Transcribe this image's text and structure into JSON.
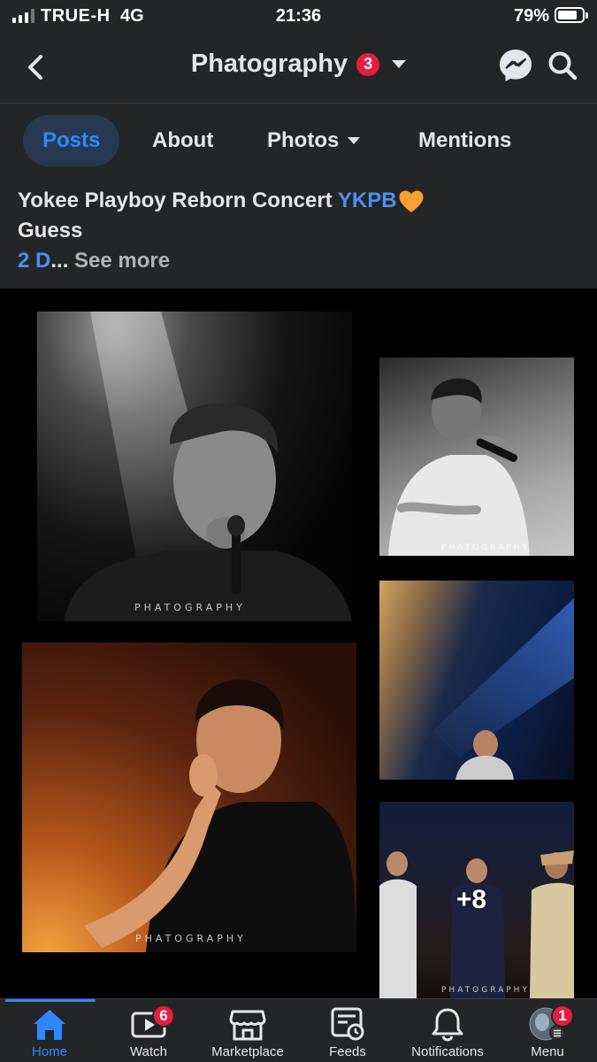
{
  "status_bar": {
    "carrier": "TRUE-H",
    "network": "4G",
    "time": "21:36",
    "battery_percent": "79%",
    "battery_level": 0.79,
    "signal_bars": 3
  },
  "header": {
    "title": "Phatography",
    "notification_count": "3",
    "icons": [
      "back-arrow-icon",
      "chevron-down-icon",
      "messenger-icon",
      "search-icon"
    ]
  },
  "tabs": [
    {
      "label": "Posts",
      "active": true
    },
    {
      "label": "About",
      "active": false
    },
    {
      "label": "Photos",
      "active": false,
      "has_dropdown": true
    },
    {
      "label": "Mentions",
      "active": false
    }
  ],
  "post": {
    "line1": "Yokee Playboy Reborn Concert ",
    "hashtag": "YKPB",
    "line2": "Guess",
    "truncated": "2 D",
    "ellipsis": "...",
    "see_more": " See more"
  },
  "photos": {
    "watermark": "PHATOGRAPHY",
    "more_count": "+8"
  },
  "bottom_nav": [
    {
      "label": "Home",
      "icon": "home-icon",
      "active": true,
      "badge": ""
    },
    {
      "label": "Watch",
      "icon": "watch-icon",
      "active": false,
      "badge": "6"
    },
    {
      "label": "Marketplace",
      "icon": "marketplace-icon",
      "active": false,
      "badge": ""
    },
    {
      "label": "Feeds",
      "icon": "feeds-icon",
      "active": false,
      "badge": ""
    },
    {
      "label": "Notifications",
      "icon": "bell-icon",
      "active": false,
      "badge": ""
    },
    {
      "label": "Menu",
      "icon": "menu-avatar-icon",
      "active": false,
      "badge": "1"
    }
  ],
  "colors": {
    "background": "#242526",
    "accent": "#2d88ff",
    "badge": "#e41e3f",
    "hashtag": "#4c8ff5",
    "text": "#e4e6eb",
    "muted": "#b0b3b8"
  }
}
